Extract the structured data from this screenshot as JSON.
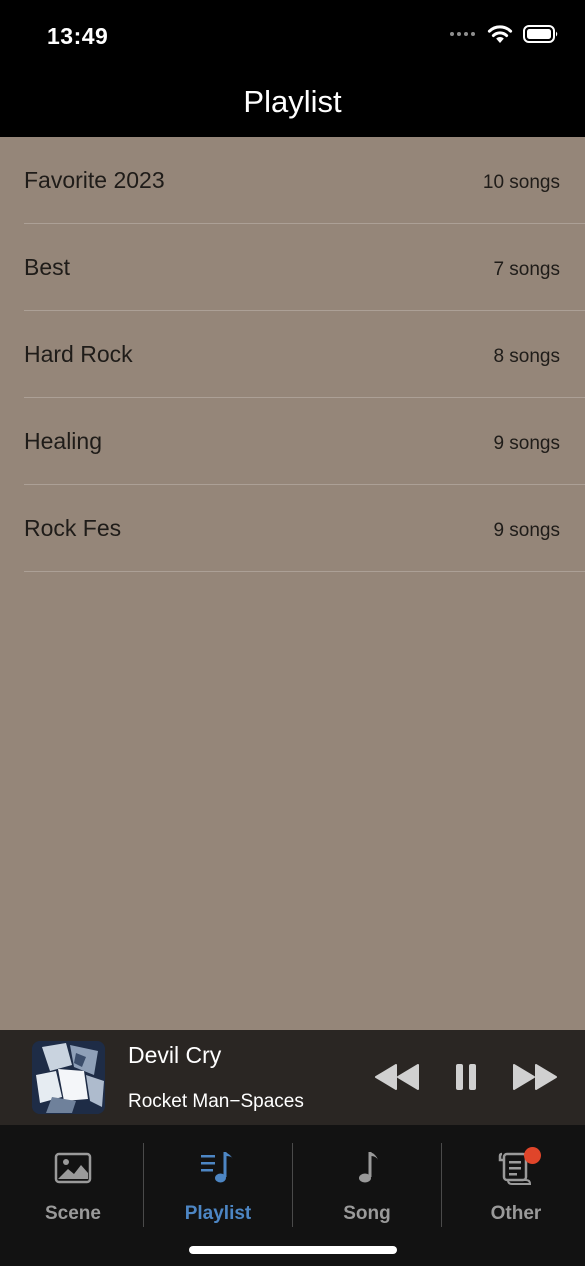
{
  "status_bar": {
    "time": "13:49"
  },
  "nav": {
    "title": "Playlist"
  },
  "playlists": [
    {
      "name": "Favorite 2023",
      "count": "10 songs"
    },
    {
      "name": "Best",
      "count": "7 songs"
    },
    {
      "name": "Hard Rock",
      "count": "8 songs"
    },
    {
      "name": "Healing",
      "count": "9 songs"
    },
    {
      "name": "Rock Fes",
      "count": "9 songs"
    }
  ],
  "now_playing": {
    "title": "Devil Cry",
    "artist": "Rocket Man−Spaces",
    "icons": [
      "rewind-icon",
      "pause-icon",
      "fast-forward-icon"
    ]
  },
  "tabs": [
    {
      "label": "Scene",
      "icon": "image-icon",
      "active": false
    },
    {
      "label": "Playlist",
      "icon": "playlist-icon",
      "active": true
    },
    {
      "label": "Song",
      "icon": "music-note-icon",
      "active": false
    },
    {
      "label": "Other",
      "icon": "scroll-icon",
      "active": false,
      "badge": true
    }
  ],
  "colors": {
    "background": "#958679",
    "accent": "#4d86c4",
    "tab_inactive": "#9a9a9a",
    "badge": "#e0452a",
    "player_bg": "#2a2623"
  }
}
